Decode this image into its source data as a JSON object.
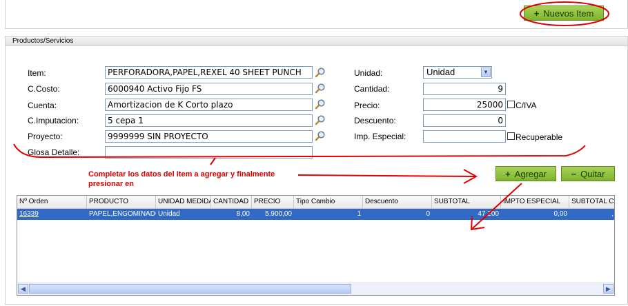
{
  "top": {
    "new_item_label": "Nuevos Item",
    "new_item_symbol": "+"
  },
  "panel": {
    "title": "Productos/Servicios"
  },
  "form": {
    "item_label": "Item:",
    "item_value": "PERFORADORA,PAPEL,REXEL 40 SHEET PUNCH",
    "ccosto_label": "C.Costo:",
    "ccosto_value": "6000940 Activo Fijo FS",
    "cuenta_label": "Cuenta:",
    "cuenta_value": "Amortizacion de K Corto plazo",
    "cimput_label": "C.Imputacion:",
    "cimput_value": "5 cepa 1",
    "proyecto_label": "Proyecto:",
    "proyecto_value": "9999999 SIN PROYECTO",
    "glosa_label": "Glosa Detalle:",
    "glosa_value": "",
    "unidad_label": "Unidad:",
    "unidad_value": "Unidad",
    "cantidad_label": "Cantidad:",
    "cantidad_value": "9",
    "precio_label": "Precio:",
    "precio_value": "25000",
    "civa_label": "C/IVA",
    "descuento_label": "Descuento:",
    "descuento_value": "0",
    "impesp_label": "Imp. Especial:",
    "impesp_value": "",
    "recuperable_label": "Recuperable"
  },
  "annotation": "Completar los datos del item a agregar y finalmente presionar en",
  "actions": {
    "agregar_label": "Agregar",
    "agregar_symbol": "+",
    "quitar_label": "Quitar",
    "quitar_symbol": "−"
  },
  "grid": {
    "columns": [
      "Nº Orden",
      "PRODUCTO",
      "UNIDAD MEDIDA",
      "CANTIDAD",
      "PRECIO",
      "Tipo Cambio",
      "Descuento",
      "SUBTOTAL",
      "IMPTO ESPECIAL",
      "SUBTOTAL C"
    ],
    "rows": [
      [
        "16339",
        "PAPEL,ENGOMINADO",
        "Unidad",
        "8,00",
        "5.900,00",
        "1",
        "0",
        "47.200",
        "0,00",
        ","
      ]
    ]
  },
  "colors": {
    "accent_green": "#7fb32c",
    "selection_blue": "#316ac5",
    "annotation_red": "#d60000"
  },
  "icons": {
    "lookup": "magnifier-icon",
    "dropdown": "chevron-down-icon",
    "scroll_left": "arrow-left-icon",
    "scroll_right": "arrow-right-icon"
  }
}
